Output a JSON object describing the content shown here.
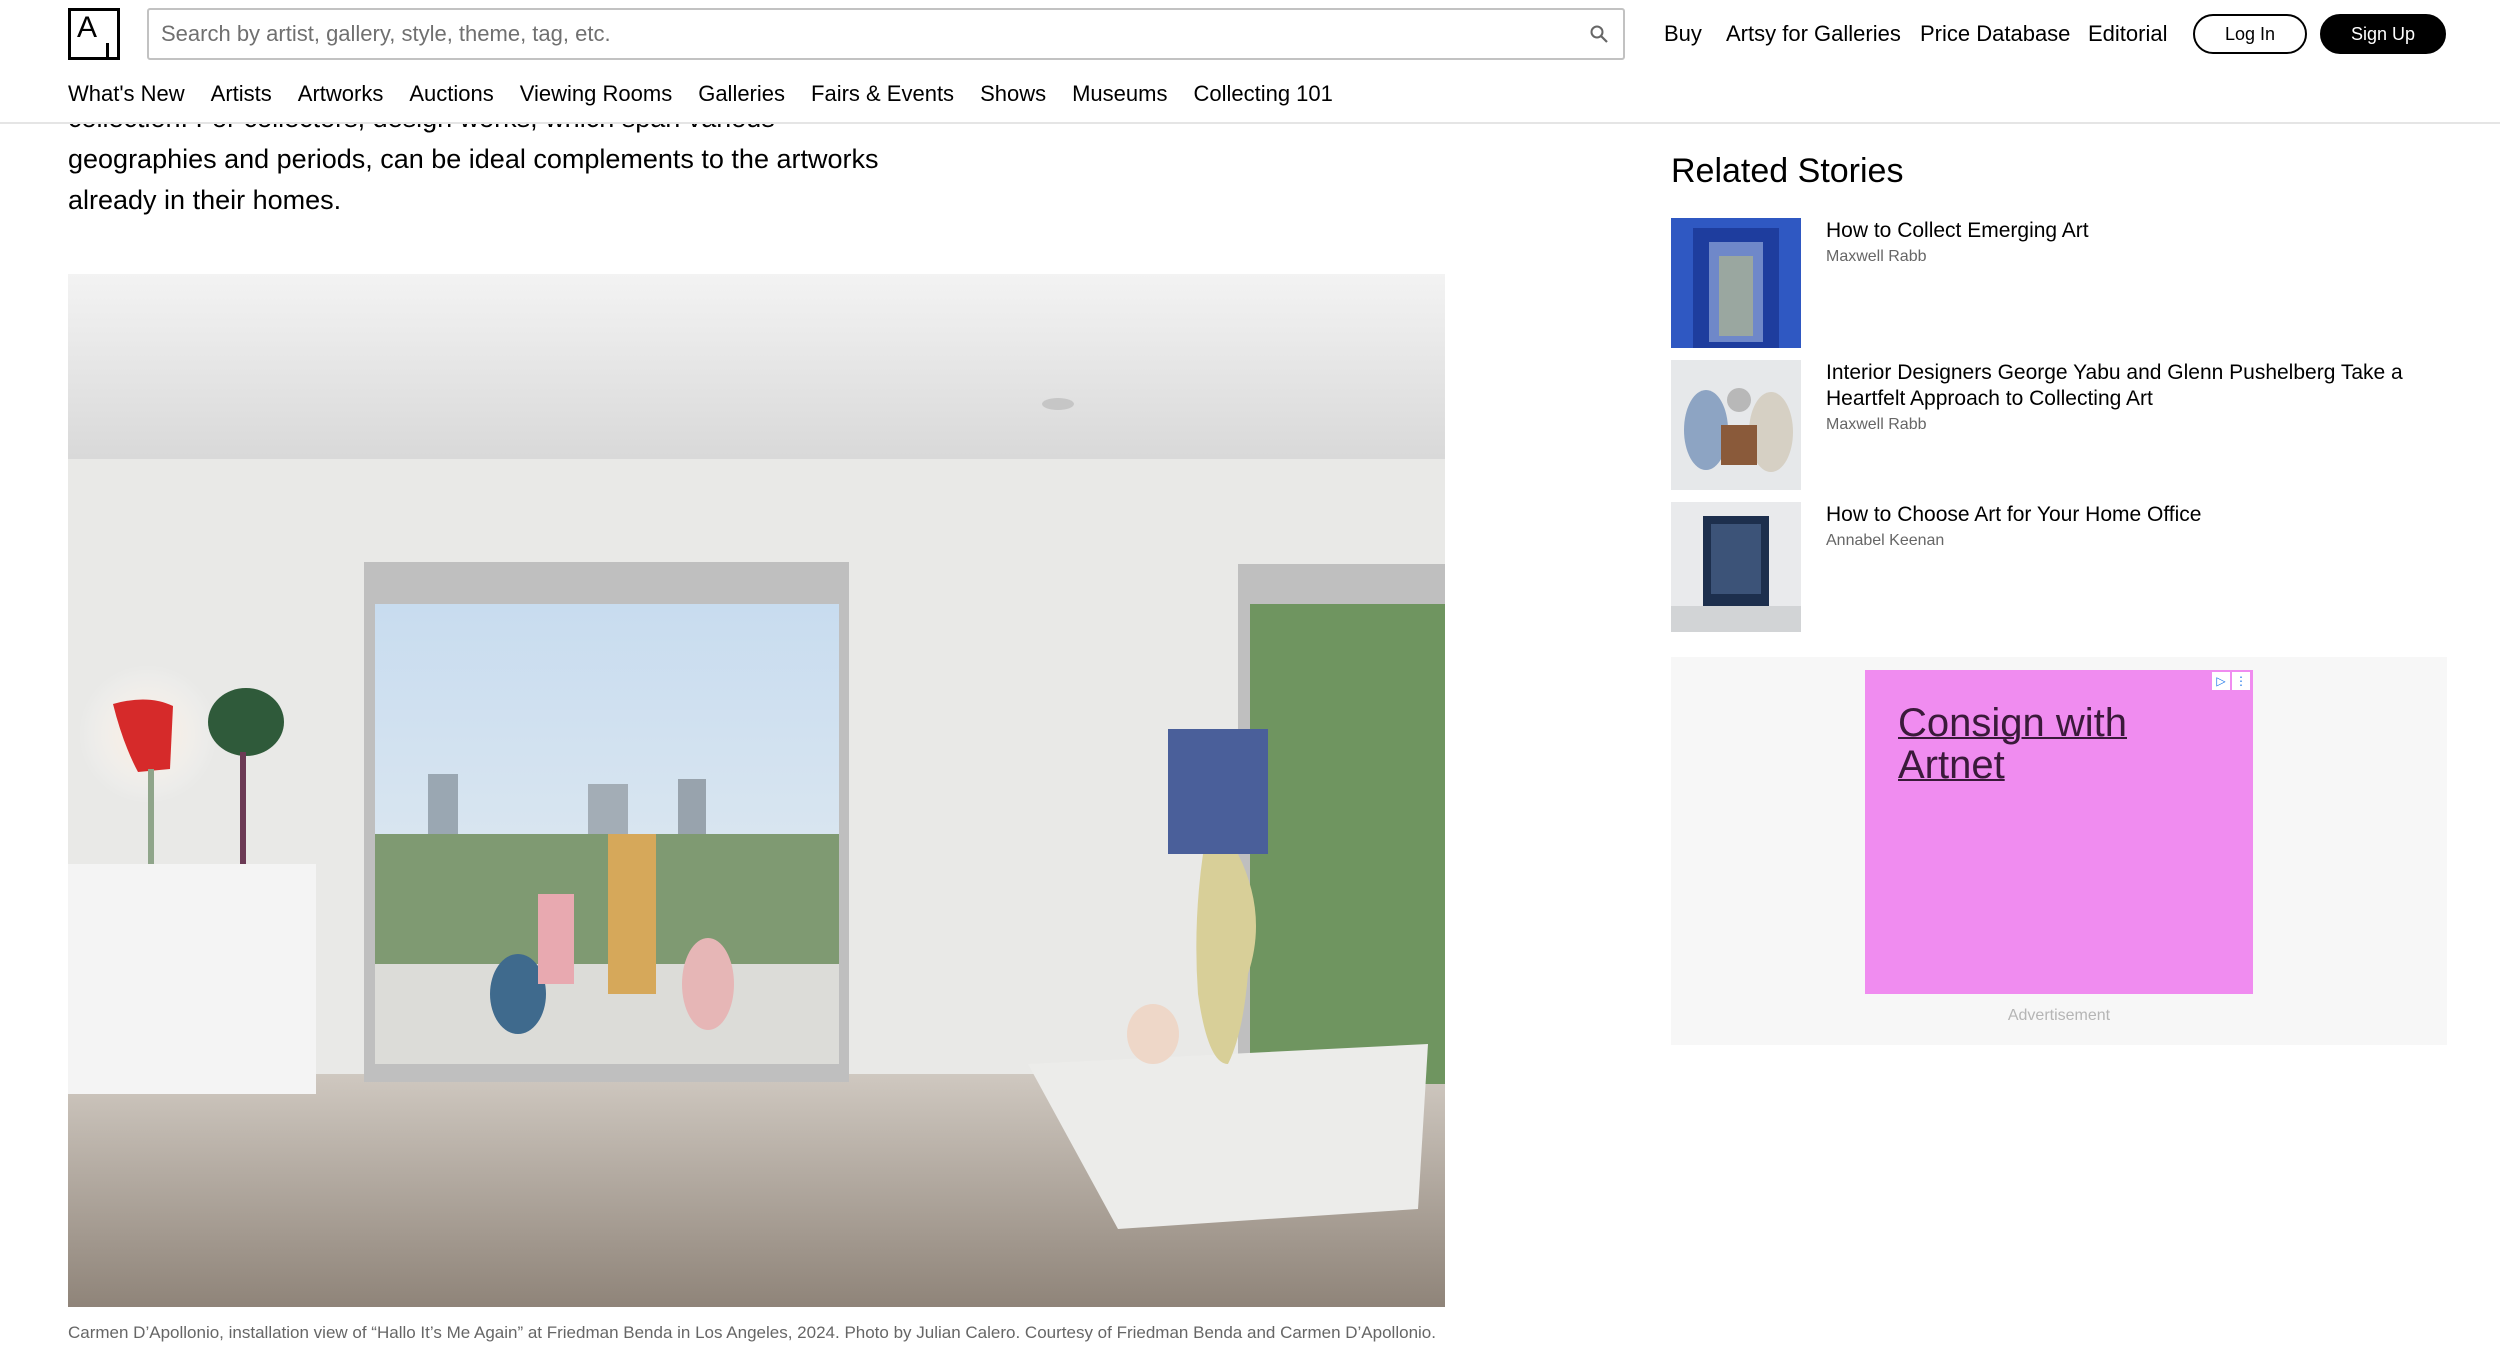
{
  "header": {
    "logo_letter": "A",
    "search_placeholder": "Search by artist, gallery, style, theme, tag, etc.",
    "top_links": [
      "Buy",
      "Artsy for Galleries",
      "Price Database",
      "Editorial"
    ],
    "login_label": "Log In",
    "signup_label": "Sign Up"
  },
  "subnav": [
    "What's New",
    "Artists",
    "Artworks",
    "Auctions",
    "Viewing Rooms",
    "Galleries",
    "Fairs & Events",
    "Shows",
    "Museums",
    "Collecting 101"
  ],
  "article": {
    "partial_line": "collection. For collectors, design works, which span various",
    "line_2": "geographies and periods, can be ideal complements to the artworks",
    "line_3": "already in their homes.",
    "caption": "Carmen D’Apollonio, installation view of “Hallo It’s Me Again” at Friedman Benda in Los Angeles, 2024. Photo by Julian Calero. Courtesy of Friedman Benda and Carmen D’Apollonio."
  },
  "sidebar": {
    "related_title": "Related Stories",
    "stories": [
      {
        "title": "How to Collect Emerging Art",
        "author": "Maxwell Rabb"
      },
      {
        "title": "Interior Designers George Yabu and Glenn Pushelberg Take a Heartfelt Approach to Collecting Art",
        "author": "Maxwell Rabb"
      },
      {
        "title": "How to Choose Art for Your Home Office",
        "author": "Annabel Keenan"
      }
    ],
    "ad": {
      "headline_line1": "Consign with",
      "headline_line2": "Artnet",
      "label": "Advertisement",
      "background_color": "#f08cf0"
    }
  }
}
